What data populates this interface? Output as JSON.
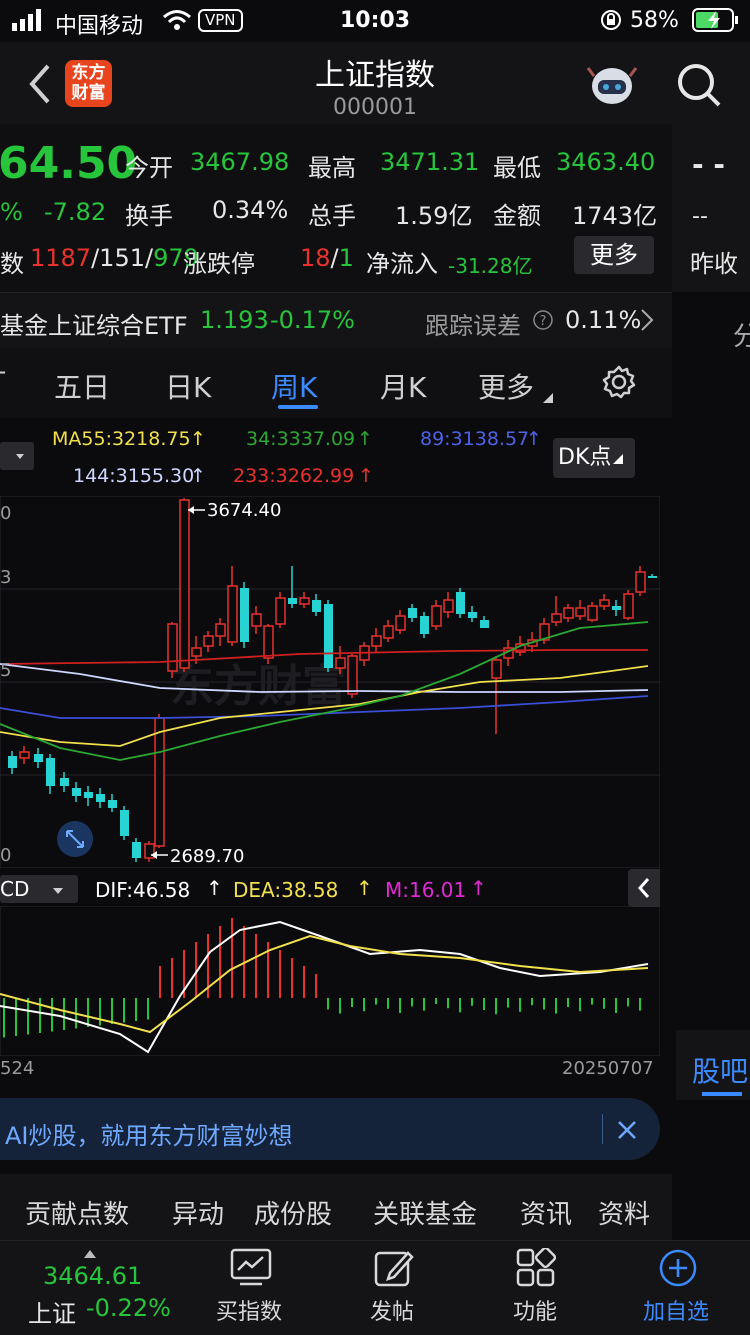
{
  "status_bar": {
    "carrier": "中国移动",
    "vpn": "VPN",
    "time": "10:03",
    "battery": "58%"
  },
  "header": {
    "title": "上证指数",
    "code": "000001",
    "logo_line1": "东方",
    "logo_line2": "财富"
  },
  "quote": {
    "price": "64.50",
    "change_pct": "%",
    "change": "-7.82",
    "breadth_label": "数",
    "open_label": "今开",
    "open": "3467.98",
    "high_label": "最高",
    "high": "3471.31",
    "low_label": "最低",
    "low": "3463.40",
    "turnover_label": "换手",
    "turnover": "0.34%",
    "volume_label": "总手",
    "volume": "1.59亿",
    "amount_label": "金额",
    "amount": "1743亿",
    "up": "1187",
    "flat": "151",
    "down": "979",
    "limit_label": "涨跌停",
    "limit_up": "18",
    "limit_down": "1",
    "netflow_label": "净流入",
    "netflow": "-31.28亿",
    "more_button": "更多",
    "right_dash": "- -",
    "right_dash2": "--",
    "prev_close_label": "昨收"
  },
  "fund": {
    "prefix": "基金",
    "name": "上证综合ETF",
    "price": "1.193",
    "change": "-0.17%",
    "tracking_label": "跟踪误差",
    "tracking": "0.11%"
  },
  "tabs": [
    {
      "label": "五日"
    },
    {
      "label": "日K"
    },
    {
      "label": "周K"
    },
    {
      "label": "月K"
    },
    {
      "label": "更多"
    }
  ],
  "active_tab": "周K",
  "right_side": {
    "label": "分",
    "guba": "股吧"
  },
  "ma": {
    "ma55": "MA55:3218.75",
    "ma34": "34:3337.09",
    "ma89": "89:3138.57",
    "ma144": "144:3155.30",
    "ma233": "233:3262.99",
    "dk_button": "DK点"
  },
  "axis": {
    "y_top": "0",
    "y_mid": "3",
    "y_low": "5",
    "y_bottom": "0",
    "date_left": "524",
    "date_right": "20250707"
  },
  "chart_data": {
    "type": "candlestick",
    "high_marker": "3674.40",
    "low_marker": "2689.70",
    "ylim": [
      2640,
      3730
    ],
    "colors": {
      "up": "#e8322b",
      "down": "#27d3d3",
      "ma55": "#f1e04b",
      "ma34": "#2aa833",
      "ma89": "#3a4fd6",
      "ma144": "#cfd6ff",
      "ma233": "#d02020"
    }
  },
  "macd": {
    "name": "CD",
    "dif": "DIF:46.58",
    "dea": "DEA:38.58",
    "m": "M:16.01"
  },
  "ad": {
    "text": "AI炒股，就用东方财富妙想"
  },
  "bottom_tabs": [
    {
      "label": "贡献点数"
    },
    {
      "label": "异动"
    },
    {
      "label": "成份股"
    },
    {
      "label": "关联基金"
    },
    {
      "label": "资讯"
    },
    {
      "label": "资料"
    }
  ],
  "toolbar": {
    "index_price": "3464.61",
    "index_name": "上证",
    "index_change": "-0.22%",
    "buy": "买指数",
    "post": "发帖",
    "func": "功能",
    "fav": "加自选"
  }
}
